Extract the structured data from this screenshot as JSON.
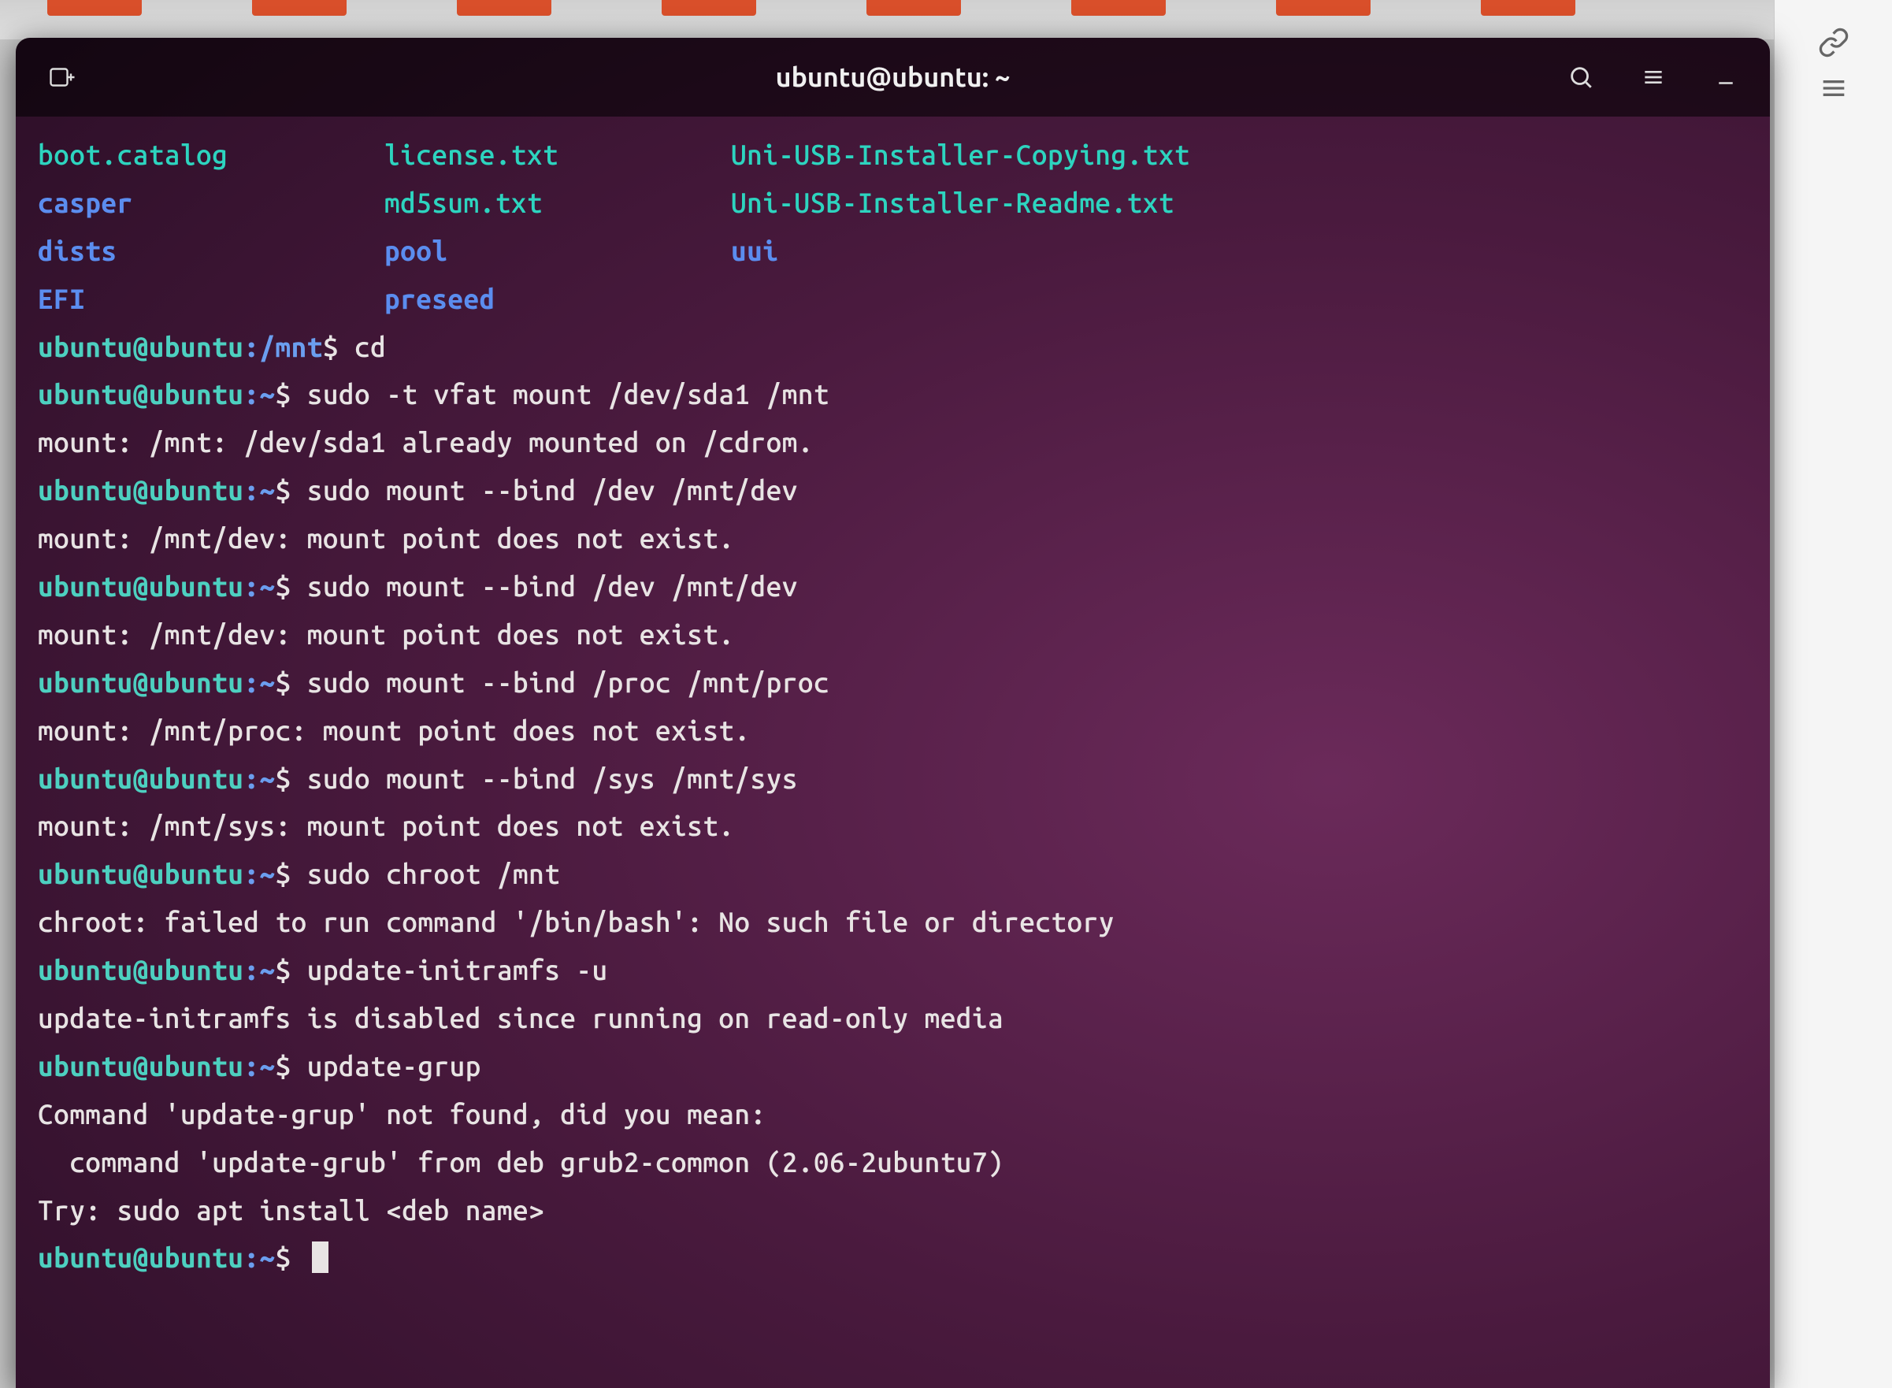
{
  "window": {
    "title": "ubuntu@ubuntu: ~"
  },
  "ls": {
    "col1": [
      "boot.catalog",
      "casper",
      "dists",
      "EFI"
    ],
    "col1_types": [
      "file",
      "dir",
      "dir",
      "dir"
    ],
    "col2": [
      "license.txt",
      "md5sum.txt",
      "pool",
      "preseed"
    ],
    "col2_types": [
      "file",
      "file",
      "dir",
      "dir"
    ],
    "col3": [
      "Uni-USB-Installer-Copying.txt",
      "Uni-USB-Installer-Readme.txt",
      "uui",
      ""
    ],
    "col3_types": [
      "file",
      "file",
      "dir",
      ""
    ]
  },
  "lines": [
    {
      "prompt_user": "ubuntu@ubuntu",
      "prompt_path": ":/mnt",
      "dollar": "$ ",
      "cmd": "cd"
    },
    {
      "prompt_user": "ubuntu@ubuntu",
      "prompt_path": ":~",
      "dollar": "$ ",
      "cmd": "sudo -t vfat mount /dev/sda1 /mnt"
    },
    {
      "out": "mount: /mnt: /dev/sda1 already mounted on /cdrom."
    },
    {
      "prompt_user": "ubuntu@ubuntu",
      "prompt_path": ":~",
      "dollar": "$ ",
      "cmd": "sudo mount --bind /dev /mnt/dev"
    },
    {
      "out": "mount: /mnt/dev: mount point does not exist."
    },
    {
      "prompt_user": "ubuntu@ubuntu",
      "prompt_path": ":~",
      "dollar": "$ ",
      "cmd": "sudo mount --bind /dev /mnt/dev"
    },
    {
      "out": "mount: /mnt/dev: mount point does not exist."
    },
    {
      "prompt_user": "ubuntu@ubuntu",
      "prompt_path": ":~",
      "dollar": "$ ",
      "cmd": "sudo mount --bind /proc /mnt/proc"
    },
    {
      "out": "mount: /mnt/proc: mount point does not exist."
    },
    {
      "prompt_user": "ubuntu@ubuntu",
      "prompt_path": ":~",
      "dollar": "$ ",
      "cmd": "sudo mount --bind /sys /mnt/sys"
    },
    {
      "out": "mount: /mnt/sys: mount point does not exist."
    },
    {
      "prompt_user": "ubuntu@ubuntu",
      "prompt_path": ":~",
      "dollar": "$ ",
      "cmd": "sudo chroot /mnt"
    },
    {
      "out": "chroot: failed to run command '/bin/bash': No such file or directory"
    },
    {
      "prompt_user": "ubuntu@ubuntu",
      "prompt_path": ":~",
      "dollar": "$ ",
      "cmd": "update-initramfs -u"
    },
    {
      "out": "update-initramfs is disabled since running on read-only media"
    },
    {
      "prompt_user": "ubuntu@ubuntu",
      "prompt_path": ":~",
      "dollar": "$ ",
      "cmd": "update-grup"
    },
    {
      "out": "Command 'update-grup' not found, did you mean:"
    },
    {
      "out": "  command 'update-grub' from deb grub2-common (2.06-2ubuntu7)"
    },
    {
      "out": "Try: sudo apt install <deb name>"
    },
    {
      "prompt_user": "ubuntu@ubuntu",
      "prompt_path": ":~",
      "dollar": "$ ",
      "cmd": "",
      "cursor": true
    }
  ]
}
